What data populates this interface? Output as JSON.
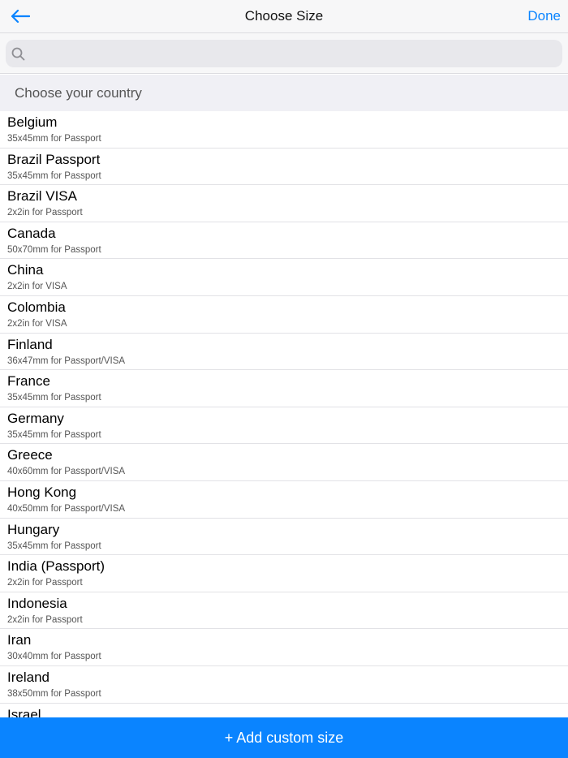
{
  "nav": {
    "title": "Choose Size",
    "done_label": "Done",
    "back_icon": "arrow-left-icon"
  },
  "search": {
    "placeholder": "",
    "value": "",
    "icon": "search-icon"
  },
  "section": {
    "title": "Choose your country"
  },
  "countries": [
    {
      "name": "Belgium",
      "desc": "35x45mm for Passport"
    },
    {
      "name": "Brazil Passport",
      "desc": "35x45mm for Passport"
    },
    {
      "name": "Brazil VISA",
      "desc": "2x2in for Passport"
    },
    {
      "name": "Canada",
      "desc": "50x70mm for Passport"
    },
    {
      "name": "China",
      "desc": "2x2in for VISA"
    },
    {
      "name": "Colombia",
      "desc": "2x2in for VISA"
    },
    {
      "name": "Finland",
      "desc": "36x47mm for Passport/VISA"
    },
    {
      "name": "France",
      "desc": "35x45mm for Passport"
    },
    {
      "name": "Germany",
      "desc": "35x45mm for Passport"
    },
    {
      "name": "Greece",
      "desc": "40x60mm for Passport/VISA"
    },
    {
      "name": "Hong Kong",
      "desc": "40x50mm for Passport/VISA"
    },
    {
      "name": "Hungary",
      "desc": "35x45mm for Passport"
    },
    {
      "name": "India (Passport)",
      "desc": "2x2in for Passport"
    },
    {
      "name": "Indonesia",
      "desc": "2x2in for Passport"
    },
    {
      "name": "Iran",
      "desc": "30x40mm for Passport"
    },
    {
      "name": "Ireland",
      "desc": "38x50mm for Passport"
    },
    {
      "name": "Israel",
      "desc": ""
    }
  ],
  "footer": {
    "add_label": "+ Add custom size"
  },
  "colors": {
    "accent": "#0a84ff"
  }
}
